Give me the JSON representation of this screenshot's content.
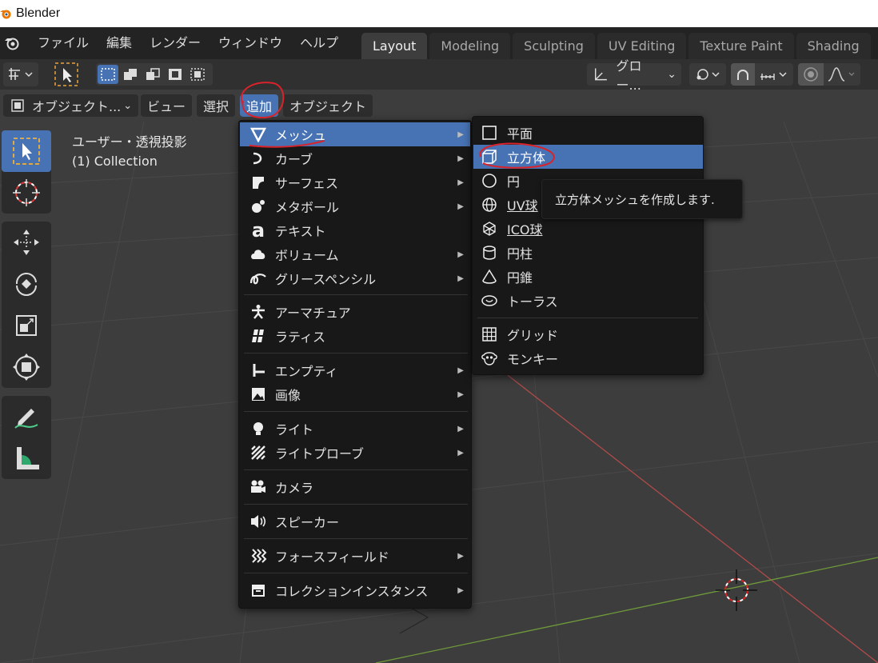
{
  "window": {
    "title": "Blender"
  },
  "menubar": [
    "ファイル",
    "編集",
    "レンダー",
    "ウィンドウ",
    "ヘルプ"
  ],
  "workspaces": [
    {
      "label": "Layout",
      "active": true
    },
    {
      "label": "Modeling"
    },
    {
      "label": "Sculpting"
    },
    {
      "label": "UV Editing"
    },
    {
      "label": "Texture Paint"
    },
    {
      "label": "Shading"
    }
  ],
  "toolheader": {
    "orientation_label": "グロー...",
    "orientation_chevron": "⌄"
  },
  "viewport_header": {
    "mode": "オブジェクト...",
    "view": "ビュー",
    "select": "選択",
    "add": "追加",
    "object": "オブジェクト"
  },
  "viewport": {
    "view_name": "ユーザー・透視投影",
    "collection": "(1) Collection"
  },
  "add_menu": {
    "items": [
      {
        "label": "メッシュ",
        "icon": "mesh-icon",
        "submenu": true,
        "active": true
      },
      {
        "label": "カーブ",
        "icon": "curve-icon",
        "submenu": true
      },
      {
        "label": "サーフェス",
        "icon": "surface-icon",
        "submenu": true
      },
      {
        "label": "メタボール",
        "icon": "metaball-icon",
        "submenu": true
      },
      {
        "label": "テキスト",
        "icon": "text-icon",
        "submenu": false
      },
      {
        "label": "ボリューム",
        "icon": "volume-icon",
        "submenu": true
      },
      {
        "label": "グリースペンシル",
        "icon": "grease-pencil-icon",
        "submenu": true
      },
      {
        "label": "アーマチュア",
        "icon": "armature-icon",
        "submenu": false
      },
      {
        "label": "ラティス",
        "icon": "lattice-icon",
        "submenu": false
      },
      {
        "label": "エンプティ",
        "icon": "empty-icon",
        "submenu": true
      },
      {
        "label": "画像",
        "icon": "image-icon",
        "submenu": true
      },
      {
        "label": "ライト",
        "icon": "light-icon",
        "submenu": true
      },
      {
        "label": "ライトプローブ",
        "icon": "light-probe-icon",
        "submenu": true
      },
      {
        "label": "カメラ",
        "icon": "camera-icon",
        "submenu": false
      },
      {
        "label": "スピーカー",
        "icon": "speaker-icon",
        "submenu": false
      },
      {
        "label": "フォースフィールド",
        "icon": "force-field-icon",
        "submenu": true
      },
      {
        "label": "コレクションインスタンス",
        "icon": "collection-instance-icon",
        "submenu": true
      }
    ]
  },
  "mesh_menu": {
    "items": [
      {
        "label": "平面",
        "icon": "plane-icon"
      },
      {
        "label": "立方体",
        "icon": "cube-icon",
        "active": true
      },
      {
        "label": "円",
        "icon": "circle-icon"
      },
      {
        "label": "UV球",
        "icon": "uv-sphere-icon"
      },
      {
        "label": "ICO球",
        "icon": "ico-sphere-icon"
      },
      {
        "label": "円柱",
        "icon": "cylinder-icon"
      },
      {
        "label": "円錐",
        "icon": "cone-icon"
      },
      {
        "label": "トーラス",
        "icon": "torus-icon"
      },
      {
        "label": "グリッド",
        "icon": "grid-icon"
      },
      {
        "label": "モンキー",
        "icon": "monkey-icon"
      }
    ]
  },
  "tooltip": {
    "text": "立方体メッシュを作成します."
  },
  "colors": {
    "accent": "#4772b3",
    "annotation": "#d8232a",
    "background": "#3d3d3d",
    "menu_bg": "#181818"
  }
}
